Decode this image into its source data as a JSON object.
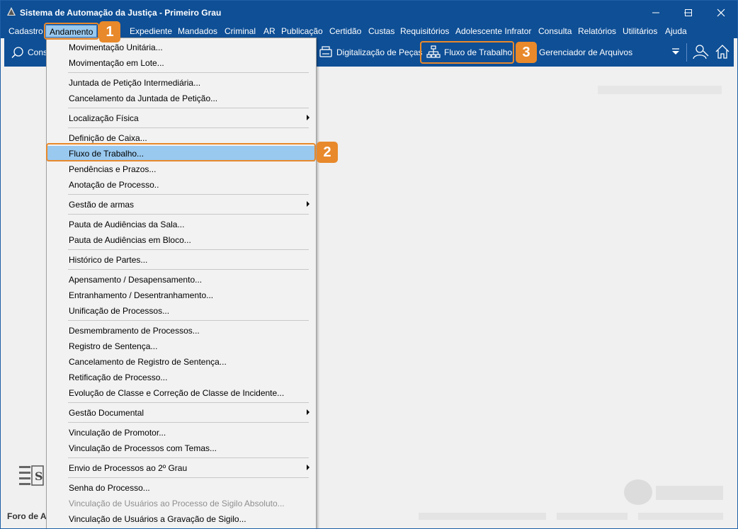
{
  "window": {
    "title": "Sistema de Automação da Justiça - Primeiro Grau",
    "minimize": "—",
    "maximize": "☐",
    "close": "✕"
  },
  "menubar": {
    "items": [
      "Cadastro",
      "Andamento",
      "Expediente",
      "Mandados",
      "Criminal",
      "AR",
      "Publicação",
      "Certidão",
      "Custas",
      "Requisitórios",
      "Adolescente Infrator",
      "Consulta",
      "Relatórios",
      "Utilitários",
      "Ajuda"
    ]
  },
  "toolbar": {
    "consulta_partial": "Cons",
    "digitalizacao": "Digitalização de Peças",
    "fluxo": "Fluxo de Trabalho",
    "gerenciador": "Gerenciador de Arquivos"
  },
  "badges": {
    "b1": "1",
    "b2": "2",
    "b3": "3"
  },
  "dropdown": {
    "items": [
      "Movimentação Unitária...",
      "Movimentação em Lote...",
      "Juntada de Petição Intermediária...",
      "Cancelamento da Juntada de Petição...",
      "Localização Física",
      "Definição de Caixa...",
      "Fluxo de Trabalho...",
      "Pendências e Prazos...",
      "Anotação de Processo..",
      "Gestão de armas",
      "Pauta de Audiências da Sala...",
      "Pauta de Audiências em Bloco...",
      "Histórico de Partes...",
      "Apensamento / Desapensamento...",
      "Entranhamento / Desentranhamento...",
      "Unificação de Processos...",
      "Desmembramento de Processos...",
      "Registro de Sentença...",
      "Cancelamento de Registro de Sentença...",
      "Retificação de Processo...",
      "Evolução de Classe e Correção de Classe de Incidente...",
      "Gestão Documental",
      "Vinculação de Promotor...",
      "Vinculação de Processos com Temas...",
      "Envio de Processos ao 2º Grau",
      "Senha do Processo...",
      "Vinculação de Usuários ao Processo de Sigilo Absoluto...",
      "Vinculação de Usuários a Gravação de Sigilo..."
    ]
  },
  "footer": {
    "foro_partial": "Foro de Ar"
  },
  "colors": {
    "brand_blue": "#0e4f96",
    "highlight": "#e8892b",
    "selected": "#99c9ef"
  }
}
